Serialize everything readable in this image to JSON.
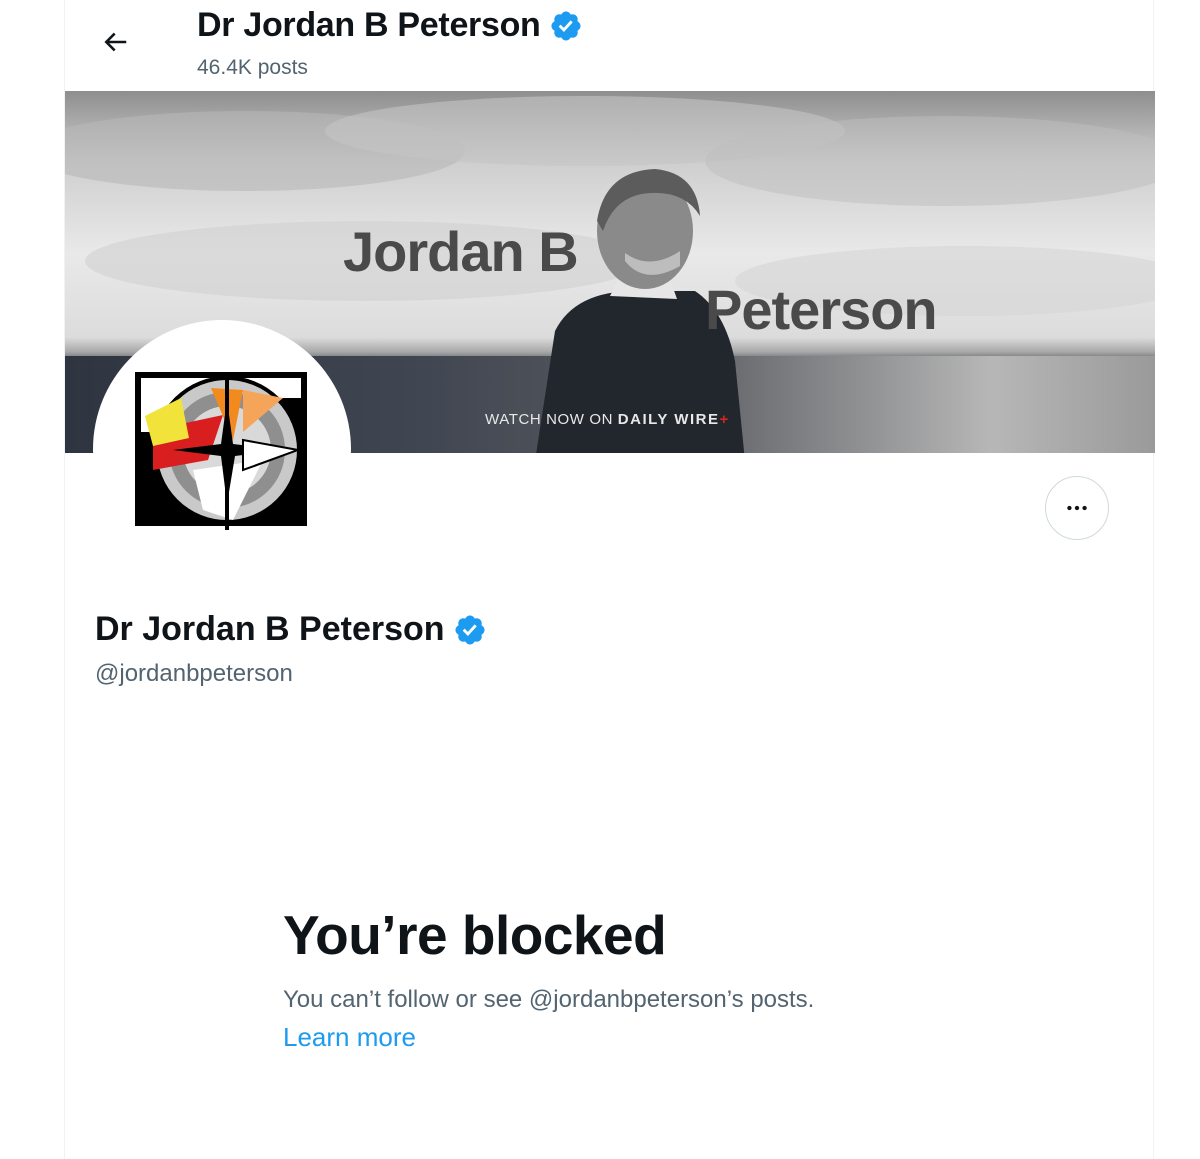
{
  "header": {
    "back_label": "Back",
    "name": "Dr Jordan B Peterson",
    "posts": "46.4K posts"
  },
  "banner": {
    "line1": "Jordan B",
    "line2": "Peterson",
    "watch_prefix": "WATCH NOW ON ",
    "watch_brand": "DAILY WIRE",
    "watch_plus": "+"
  },
  "profile": {
    "name": "Dr Jordan B Peterson",
    "handle": "@jordanbpeterson",
    "more_label": "More"
  },
  "blocked": {
    "title": "You’re blocked",
    "description": "You can’t follow or see @jordanbpeterson’s posts.",
    "learn_more": "Learn more"
  },
  "colors": {
    "text_primary": "#0f1419",
    "text_secondary": "#536471",
    "link": "#1d9bf0",
    "verified": "#1d9bf0",
    "border": "#cfd9de"
  },
  "icons": [
    "arrow-left-icon",
    "verified-badge-icon",
    "more-horizontal-icon"
  ]
}
